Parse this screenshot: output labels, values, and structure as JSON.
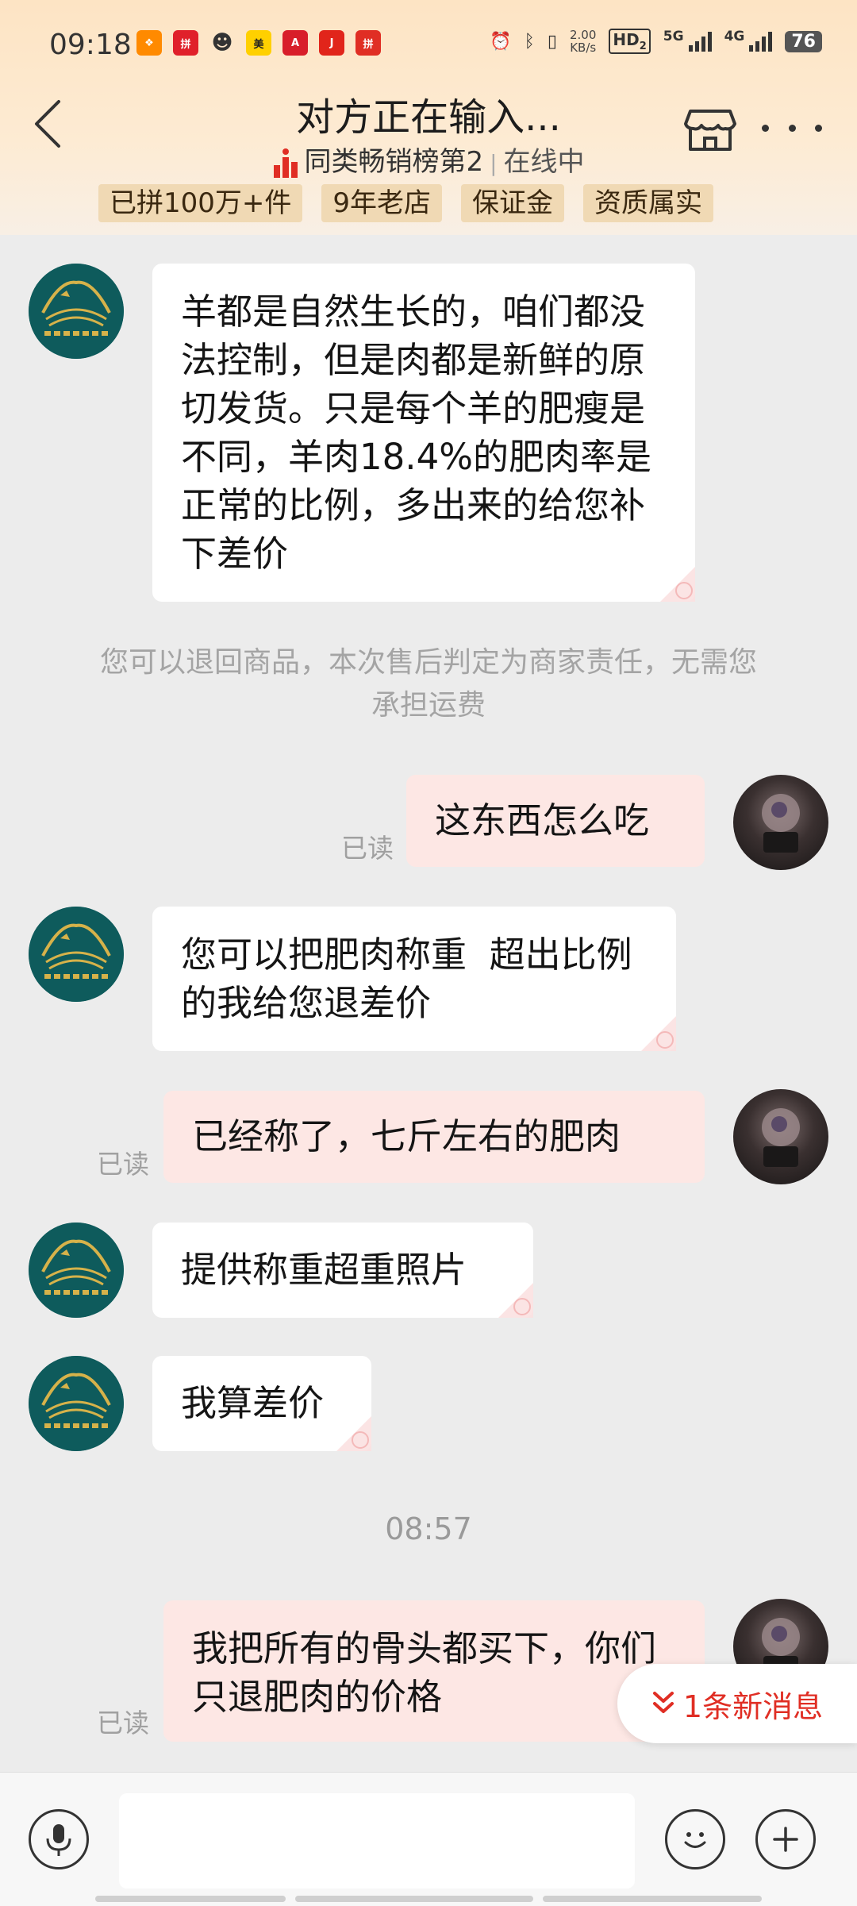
{
  "status_bar": {
    "time": "09:18",
    "net_speed_value": "2.00",
    "net_speed_unit": "KB/s",
    "sim1_label": "HD",
    "sim1_sub": "2",
    "sig1_tech": "5G",
    "sig2_tech": "4G",
    "battery": "76",
    "app_icons": [
      "taobao-icon",
      "wechat-icon",
      "meituan-icon",
      "app-icon-red",
      "jd-icon",
      "pinduoduo-icon"
    ]
  },
  "header": {
    "title": "对方正在输入...",
    "rank": "同类畅销榜第2",
    "status": "在线中",
    "badges": [
      "已拼100万+件",
      "9年老店",
      "保证金",
      "资质属实"
    ]
  },
  "messages": {
    "m1": "羊都是自然生长的，咱们都没法控制，但是肉都是新鲜的原切发货。只是每个羊的肥瘦是不同，羊肉18.4%的肥肉率是正常的比例，多出来的给您补下差价",
    "system": "您可以退回商品，本次售后判定为商家责任，无需您承担运费",
    "m2": "这东西怎么吃",
    "m3": "您可以把肥肉称重  超出比例的我给您退差价",
    "m4": "已经称了，七斤左右的肥肉",
    "m5": "提供称重超重照片",
    "m6": "我算差价",
    "timestamp": "08:57",
    "m7": "我把所有的骨头都买下，你们只退肥肉的价格",
    "read_label": "已读"
  },
  "new_messages": "1条新消息",
  "input": {
    "placeholder": ""
  },
  "colors": {
    "accent_red": "#e02e24",
    "out_bubble": "#fde7e4",
    "badge_bg": "#f0d9b4"
  }
}
